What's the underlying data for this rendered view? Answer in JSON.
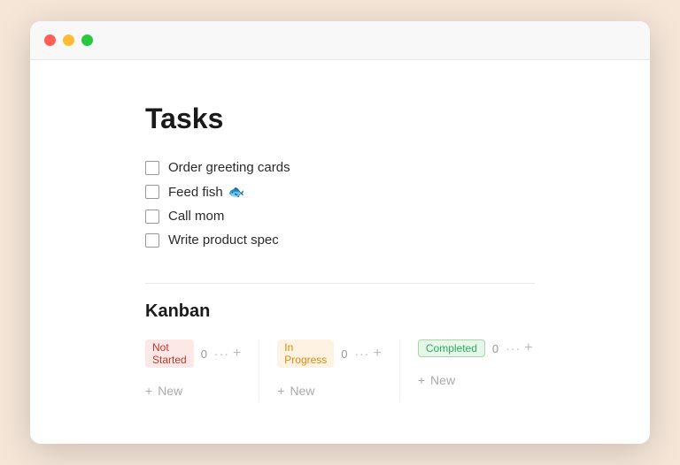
{
  "window": {
    "title": "Tasks"
  },
  "titlebar": {
    "close_label": "",
    "minimize_label": "",
    "maximize_label": ""
  },
  "page": {
    "title": "Tasks"
  },
  "tasks": {
    "section_label": "Tasks",
    "items": [
      {
        "id": "task-1",
        "label": "Order greeting cards",
        "emoji": "",
        "checked": false
      },
      {
        "id": "task-2",
        "label": "Feed fish",
        "emoji": "🐟",
        "checked": false
      },
      {
        "id": "task-3",
        "label": "Call mom",
        "emoji": "",
        "checked": false
      },
      {
        "id": "task-4",
        "label": "Write product spec",
        "emoji": "",
        "checked": false
      }
    ]
  },
  "kanban": {
    "section_label": "Kanban",
    "columns": [
      {
        "id": "not-started",
        "badge_label": "Not Started",
        "badge_class": "badge-not-started",
        "count": "0",
        "new_label": "New"
      },
      {
        "id": "in-progress",
        "badge_label": "In Progress",
        "badge_class": "badge-in-progress",
        "count": "0",
        "new_label": "New"
      },
      {
        "id": "completed",
        "badge_label": "Completed",
        "badge_class": "badge-completed",
        "count": "0",
        "new_label": "New"
      }
    ],
    "dots_label": "···",
    "plus_label": "+"
  }
}
